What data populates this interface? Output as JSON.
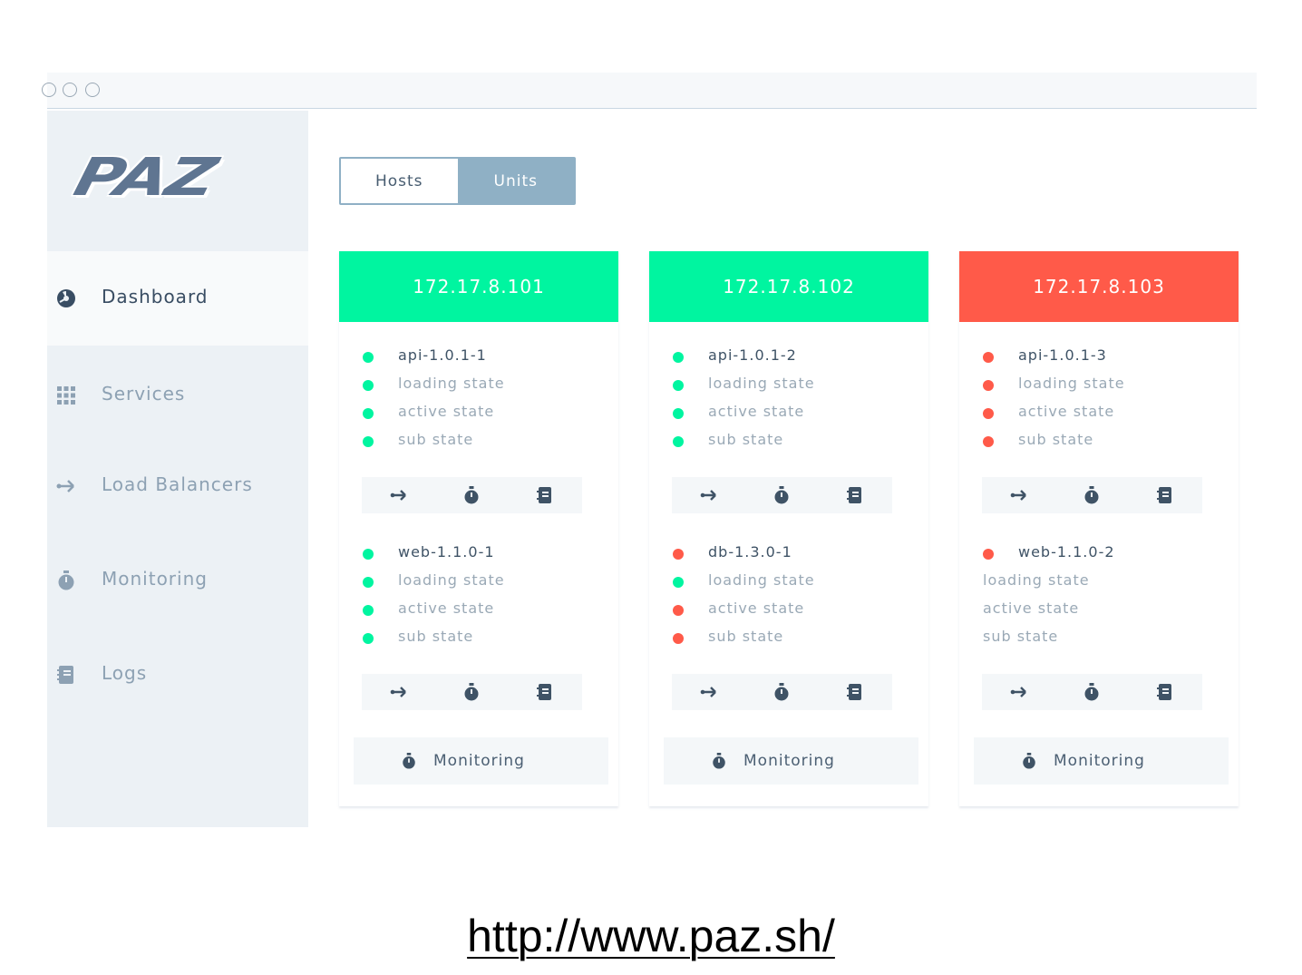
{
  "app": {
    "logo_text": "PAZ"
  },
  "colors": {
    "ok": "#00f5a0",
    "error": "#ff5a49",
    "accent": "#8fb0c5"
  },
  "sidebar": {
    "items": [
      {
        "label": "Dashboard",
        "icon": "gauge-icon",
        "active": true
      },
      {
        "label": "Services",
        "icon": "grid-icon",
        "active": false
      },
      {
        "label": "Load Balancers",
        "icon": "share-icon",
        "active": false
      },
      {
        "label": "Monitoring",
        "icon": "stopwatch-icon",
        "active": false
      },
      {
        "label": "Logs",
        "icon": "notebook-icon",
        "active": false
      }
    ]
  },
  "toggle": {
    "hosts_label": "Hosts",
    "units_label": "Units",
    "selected": "Hosts"
  },
  "hosts": [
    {
      "ip": "172.17.8.101",
      "status": "ok",
      "units": [
        {
          "name": "api-1.0.1-1",
          "status": "ok",
          "states": [
            {
              "label": "loading state",
              "status": "ok"
            },
            {
              "label": "active state",
              "status": "ok"
            },
            {
              "label": "sub state",
              "status": "ok"
            }
          ]
        },
        {
          "name": "web-1.1.0-1",
          "status": "ok",
          "states": [
            {
              "label": "loading state",
              "status": "ok"
            },
            {
              "label": "active state",
              "status": "ok"
            },
            {
              "label": "sub state",
              "status": "ok"
            }
          ]
        }
      ],
      "monitoring_label": "Monitoring"
    },
    {
      "ip": "172.17.8.102",
      "status": "ok",
      "units": [
        {
          "name": "api-1.0.1-2",
          "status": "ok",
          "states": [
            {
              "label": "loading state",
              "status": "ok"
            },
            {
              "label": "active state",
              "status": "ok"
            },
            {
              "label": "sub state",
              "status": "ok"
            }
          ]
        },
        {
          "name": "db-1.3.0-1",
          "status": "error",
          "states": [
            {
              "label": "loading state",
              "status": "ok"
            },
            {
              "label": "active state",
              "status": "error"
            },
            {
              "label": "sub state",
              "status": "error"
            }
          ]
        }
      ],
      "monitoring_label": "Monitoring"
    },
    {
      "ip": "172.17.8.103",
      "status": "error",
      "units": [
        {
          "name": "api-1.0.1-3",
          "status": "error",
          "states": [
            {
              "label": "loading state",
              "status": "error"
            },
            {
              "label": "active state",
              "status": "error"
            },
            {
              "label": "sub state",
              "status": "error"
            }
          ]
        },
        {
          "name": "web-1.1.0-2",
          "status": "error",
          "states": [
            {
              "label": "loading state",
              "status": "none"
            },
            {
              "label": "active state",
              "status": "none"
            },
            {
              "label": "sub state",
              "status": "none"
            }
          ]
        }
      ],
      "monitoring_label": "Monitoring"
    }
  ],
  "footer": {
    "url": "http://www.paz.sh/"
  }
}
